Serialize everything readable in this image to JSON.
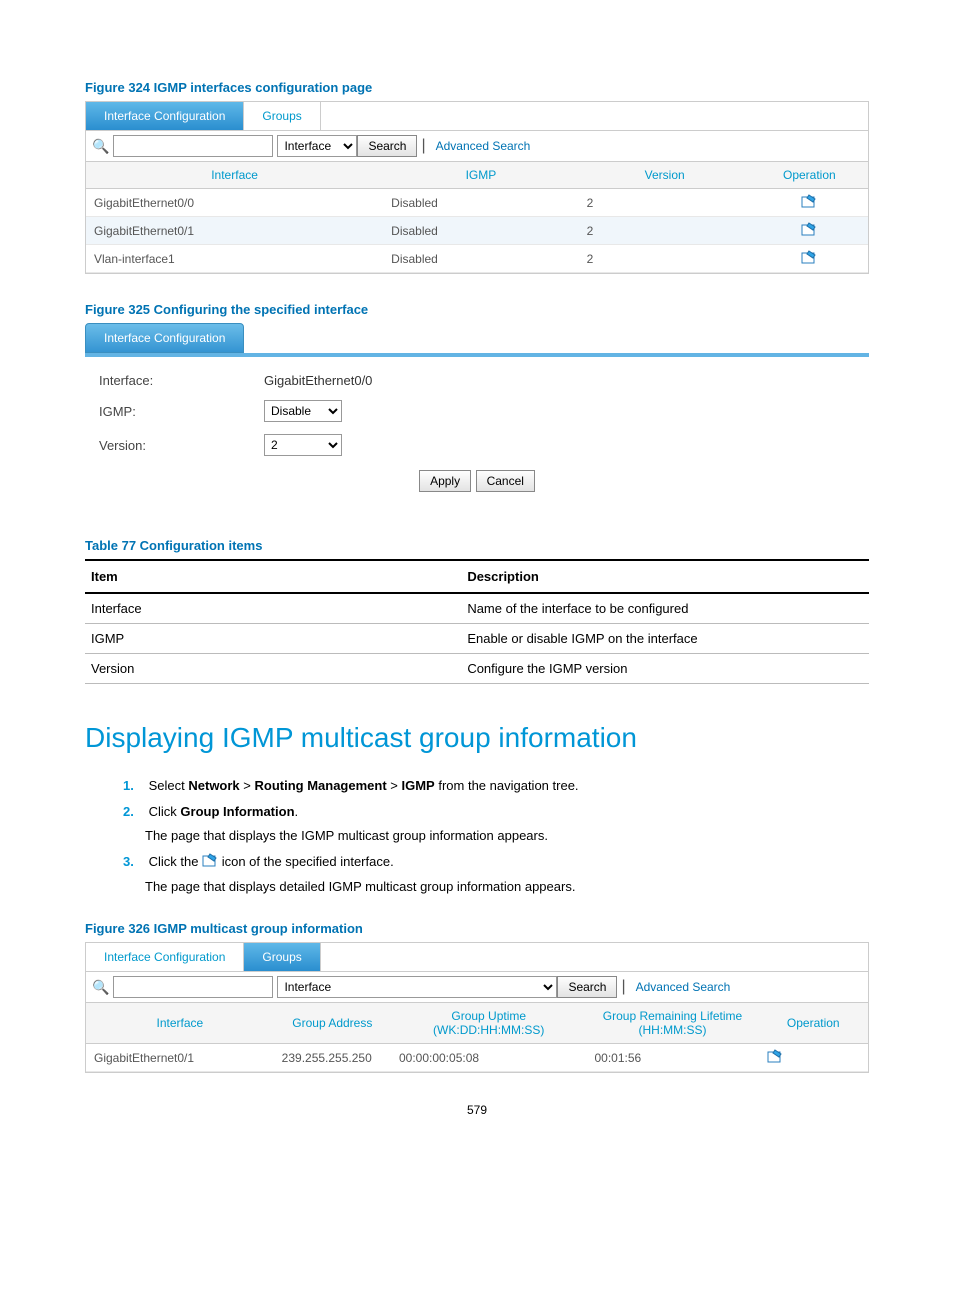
{
  "fig324": {
    "caption": "Figure 324 IGMP interfaces configuration page",
    "tabs": {
      "active": "Interface Configuration",
      "other": "Groups"
    },
    "search": {
      "select": "Interface",
      "button": "Search",
      "advanced": "Advanced Search"
    },
    "headers": [
      "Interface",
      "IGMP",
      "Version",
      "Operation"
    ],
    "rows": [
      {
        "interface": "GigabitEthernet0/0",
        "igmp": "Disabled",
        "version": "2"
      },
      {
        "interface": "GigabitEthernet0/1",
        "igmp": "Disabled",
        "version": "2"
      },
      {
        "interface": "Vlan-interface1",
        "igmp": "Disabled",
        "version": "2"
      }
    ]
  },
  "fig325": {
    "caption": "Figure 325 Configuring the specified interface",
    "tab": "Interface Configuration",
    "fields": {
      "interface_label": "Interface:",
      "interface_value": "GigabitEthernet0/0",
      "igmp_label": "IGMP:",
      "igmp_value": "Disable",
      "version_label": "Version:",
      "version_value": "2",
      "apply": "Apply",
      "cancel": "Cancel"
    }
  },
  "table77": {
    "caption": "Table 77 Configuration items",
    "headers": [
      "Item",
      "Description"
    ],
    "rows": [
      {
        "item": "Interface",
        "desc": "Name of the interface to be configured"
      },
      {
        "item": "IGMP",
        "desc": "Enable or disable IGMP on the interface"
      },
      {
        "item": "Version",
        "desc": "Configure the IGMP version"
      }
    ]
  },
  "section": {
    "heading": "Displaying IGMP multicast group information",
    "steps": [
      {
        "n": "1.",
        "prefix": "Select ",
        "nav": "Network > Routing Management > IGMP",
        "suffix": " from the navigation tree."
      },
      {
        "n": "2.",
        "prefix": "Click ",
        "bold": "Group Information",
        "suffix": ".",
        "after": "The page that displays the IGMP multicast group information appears."
      },
      {
        "n": "3.",
        "prefix": "Click the ",
        "suffix": " icon of the specified interface.",
        "after": "The page that displays detailed IGMP multicast group information appears."
      }
    ]
  },
  "fig326": {
    "caption": "Figure 326 IGMP multicast group information",
    "tabs": {
      "other": "Interface Configuration",
      "active": "Groups"
    },
    "search": {
      "select": "Interface",
      "button": "Search",
      "advanced": "Advanced Search"
    },
    "headers": [
      "Interface",
      "Group Address",
      "Group Uptime (WK:DD:HH:MM:SS)",
      "Group Remaining Lifetime (HH:MM:SS)",
      "Operation"
    ],
    "rows": [
      {
        "interface": "GigabitEthernet0/1",
        "addr": "239.255.255.250",
        "uptime": "00:00:00:05:08",
        "lifetime": "00:01:56"
      }
    ]
  },
  "page": "579"
}
